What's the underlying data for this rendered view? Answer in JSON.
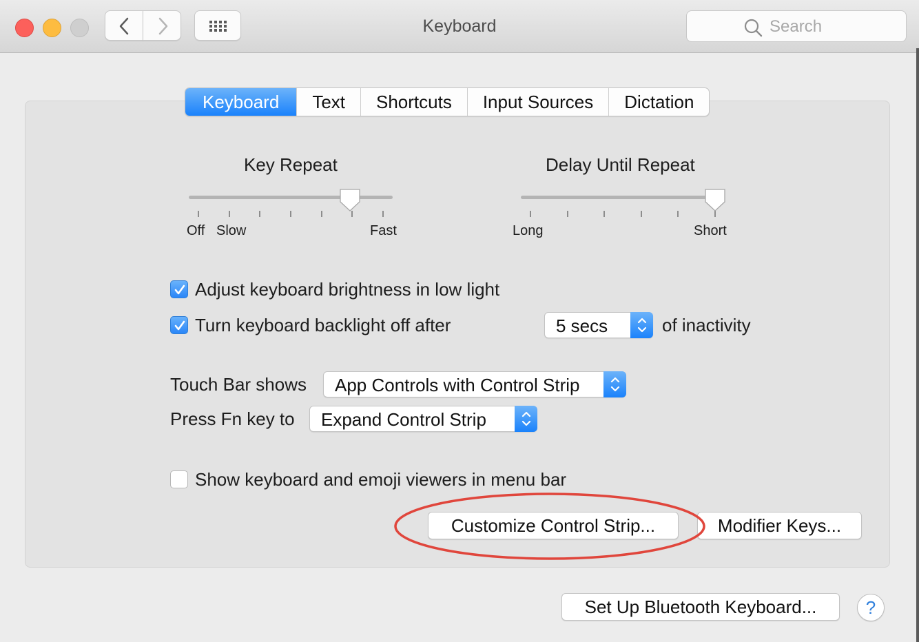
{
  "window": {
    "title": "Keyboard",
    "search_placeholder": "Search"
  },
  "tabs": [
    {
      "label": "Keyboard",
      "active": true
    },
    {
      "label": "Text",
      "active": false
    },
    {
      "label": "Shortcuts",
      "active": false
    },
    {
      "label": "Input Sources",
      "active": false
    },
    {
      "label": "Dictation",
      "active": false
    }
  ],
  "key_repeat": {
    "title": "Key Repeat",
    "label_off": "Off",
    "label_slow": "Slow",
    "label_fast": "Fast",
    "ticks": 7,
    "value_fraction": 0.82
  },
  "delay_until_repeat": {
    "title": "Delay Until Repeat",
    "label_long": "Long",
    "label_short": "Short",
    "ticks": 6,
    "value_fraction": 1.0
  },
  "options": {
    "adjust_brightness": {
      "label": "Adjust keyboard brightness in low light",
      "checked": true
    },
    "backlight_off": {
      "label": "Turn keyboard backlight off after",
      "checked": true,
      "value": "5 secs",
      "suffix": "of inactivity"
    },
    "touch_bar": {
      "label": "Touch Bar shows",
      "value": "App Controls with Control Strip"
    },
    "fn_key": {
      "label": "Press Fn key to",
      "value": "Expand Control Strip"
    },
    "emoji_viewers": {
      "label": "Show keyboard and emoji viewers in menu bar",
      "checked": false
    }
  },
  "buttons": {
    "customize": "Customize Control Strip...",
    "modifier": "Modifier Keys...",
    "bluetooth": "Set Up Bluetooth Keyboard...",
    "help": "?"
  },
  "colors": {
    "accent": "#1a82fb",
    "annotation": "#e0463c"
  }
}
